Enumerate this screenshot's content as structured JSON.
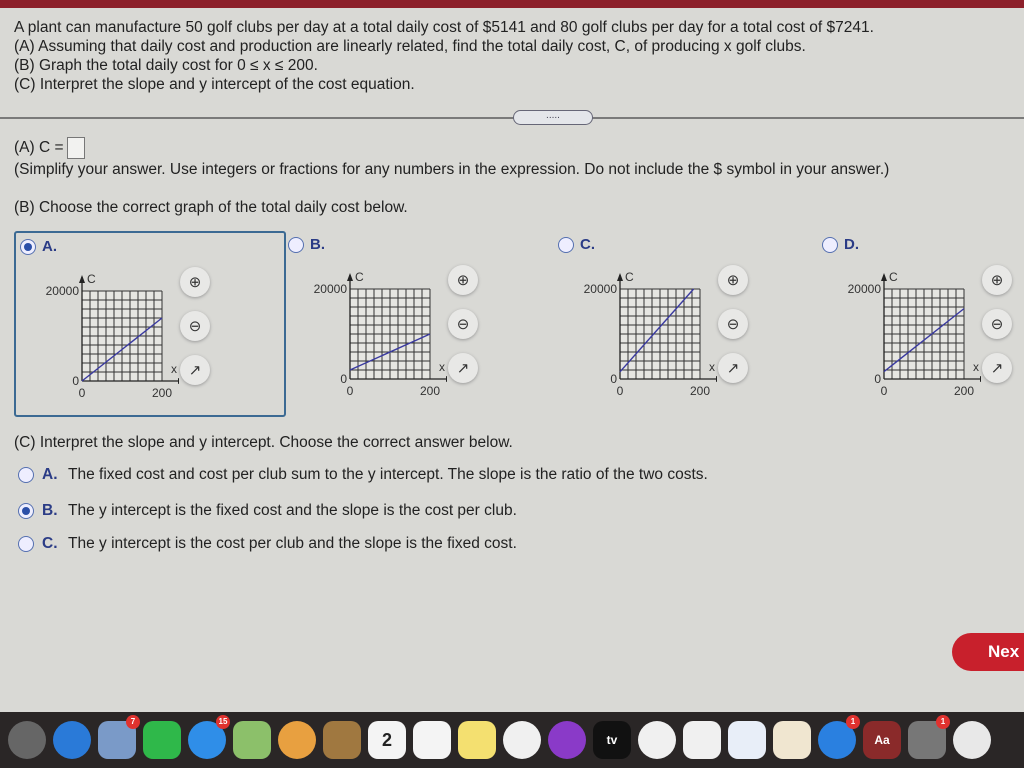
{
  "problem": {
    "lines": [
      "A plant can manufacture 50 golf clubs per day at a total daily cost of $5141 and 80 golf clubs per day for a total cost of $7241.",
      "(A) Assuming that daily cost and production are linearly related, find the total daily cost, C, of producing x golf clubs.",
      "(B) Graph the total daily cost for 0 ≤ x ≤ 200.",
      "(C) Interpret the slope and y intercept of the cost equation."
    ]
  },
  "divider_handle": ".....",
  "partA": {
    "label": "(A) C =",
    "value": "",
    "hint": "(Simplify your answer. Use integers or fractions for any numbers in the expression. Do not include the $ symbol in your answer.)"
  },
  "partB": {
    "prompt": "(B) Choose the correct graph of the total daily cost below.",
    "selected": "A",
    "options": [
      {
        "letter": "A.",
        "selected": true
      },
      {
        "letter": "B.",
        "selected": false
      },
      {
        "letter": "C.",
        "selected": false
      },
      {
        "letter": "D.",
        "selected": false
      }
    ]
  },
  "chart_data": [
    {
      "type": "line",
      "option": "A",
      "xlabel": "x",
      "ylabel": "C",
      "xlim": [
        0,
        200
      ],
      "ylim": [
        0,
        20000
      ],
      "x_ticks": [
        "0",
        "200"
      ],
      "y_ticks": [
        "0",
        "20000"
      ],
      "grid": true,
      "color": "#3a3aa0",
      "x": [
        0,
        200
      ],
      "y": [
        0,
        14000
      ]
    },
    {
      "type": "line",
      "option": "B",
      "xlabel": "x",
      "ylabel": "C",
      "xlim": [
        0,
        200
      ],
      "ylim": [
        0,
        20000
      ],
      "x_ticks": [
        "0",
        "200"
      ],
      "y_ticks": [
        "0",
        "20000"
      ],
      "grid": true,
      "color": "#3a3aa0",
      "x": [
        0,
        200
      ],
      "y": [
        2000,
        10000
      ]
    },
    {
      "type": "line",
      "option": "C",
      "xlabel": "x",
      "ylabel": "C",
      "xlim": [
        0,
        200
      ],
      "ylim": [
        0,
        20000
      ],
      "x_ticks": [
        "0",
        "200"
      ],
      "y_ticks": [
        "0",
        "20000"
      ],
      "grid": true,
      "color": "#3a3aa0",
      "x": [
        0,
        184
      ],
      "y": [
        1600,
        20000
      ]
    },
    {
      "type": "line",
      "option": "D",
      "xlabel": "x",
      "ylabel": "C",
      "xlim": [
        0,
        200
      ],
      "ylim": [
        0,
        20000
      ],
      "x_ticks": [
        "0",
        "200"
      ],
      "y_ticks": [
        "0",
        "20000"
      ],
      "grid": true,
      "color": "#3a3aa0",
      "x": [
        0,
        200
      ],
      "y": [
        1641,
        15641
      ]
    }
  ],
  "partC": {
    "prompt": "(C) Interpret the slope and y intercept. Choose the correct answer below.",
    "selected": "B",
    "choices": [
      {
        "letter": "A.",
        "text": "The fixed cost and cost per club sum to the y intercept. The slope is the ratio of the two costs.",
        "selected": false
      },
      {
        "letter": "B.",
        "text": "The y intercept is the fixed cost and the slope is the cost per club.",
        "selected": true
      },
      {
        "letter": "C.",
        "text": "The y intercept is the cost per club and the slope is the fixed cost.",
        "selected": false
      }
    ]
  },
  "next_label": "Nex",
  "dock": [
    {
      "name": "launchpad",
      "color": "#666",
      "badge": ""
    },
    {
      "name": "safari",
      "color": "#2a7ad8",
      "badge": ""
    },
    {
      "name": "mail",
      "color": "#7a9ac8",
      "badge": "7"
    },
    {
      "name": "facetime",
      "color": "#2fb84a",
      "badge": ""
    },
    {
      "name": "messages",
      "color": "#2f8ee8",
      "badge": "15"
    },
    {
      "name": "maps",
      "color": "#8cc06a",
      "badge": ""
    },
    {
      "name": "photos",
      "color": "#e8a040",
      "badge": ""
    },
    {
      "name": "contacts",
      "color": "#a07840",
      "badge": ""
    },
    {
      "name": "calendar",
      "color": "#f4f4f4",
      "badge": "",
      "text": "2"
    },
    {
      "name": "reminders",
      "color": "#f4f4f4",
      "badge": ""
    },
    {
      "name": "notes",
      "color": "#f4e070",
      "badge": ""
    },
    {
      "name": "music",
      "color": "#f0f0f0",
      "badge": ""
    },
    {
      "name": "podcasts",
      "color": "#8a3ac8",
      "badge": ""
    },
    {
      "name": "tv",
      "color": "#111",
      "badge": "",
      "text": "tv"
    },
    {
      "name": "news",
      "color": "#f0f0f0",
      "badge": ""
    },
    {
      "name": "numbers",
      "color": "#f0f0f0",
      "badge": ""
    },
    {
      "name": "keynote",
      "color": "#e8eef8",
      "badge": ""
    },
    {
      "name": "pages",
      "color": "#f0e6d0",
      "badge": ""
    },
    {
      "name": "app-store",
      "color": "#2a80e0",
      "badge": "1"
    },
    {
      "name": "dictionary",
      "color": "#8a2a2a",
      "badge": "",
      "text": "Aa"
    },
    {
      "name": "system-preferences",
      "color": "#777",
      "badge": "1"
    },
    {
      "name": "chrome",
      "color": "#e8e8e8",
      "badge": ""
    }
  ]
}
